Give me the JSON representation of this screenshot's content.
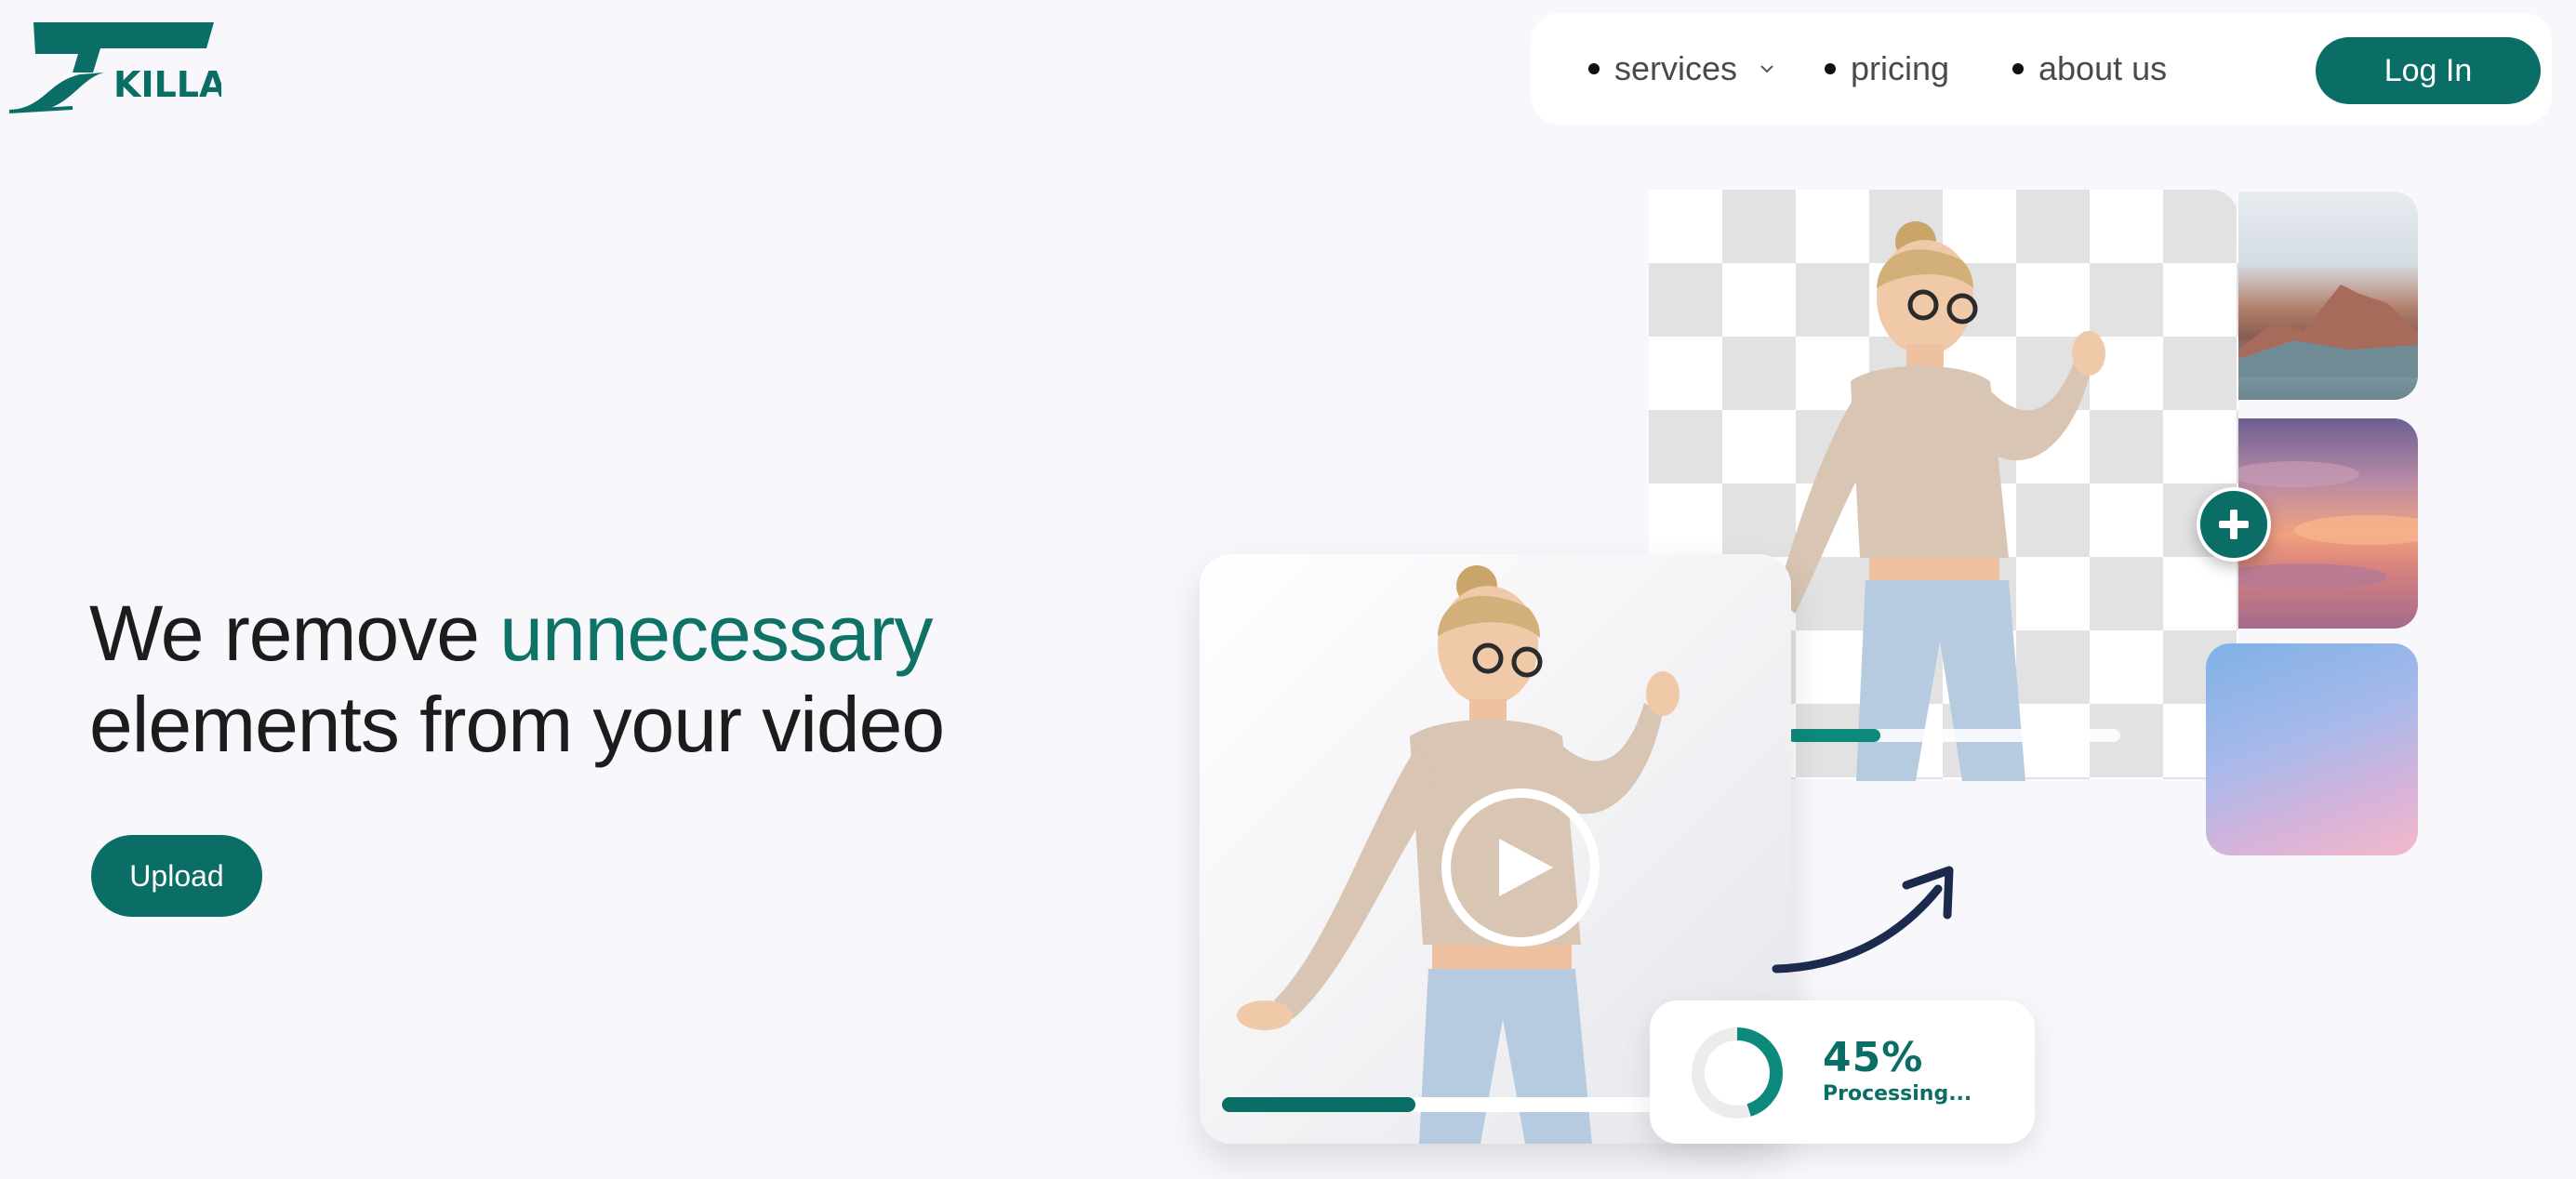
{
  "brand": {
    "name": "KILLA",
    "color": "#0b6e66"
  },
  "nav": {
    "items": [
      {
        "label": "services",
        "has_dropdown": true
      },
      {
        "label": "pricing",
        "has_dropdown": false
      },
      {
        "label": "about us",
        "has_dropdown": false
      }
    ],
    "login_label": "Log In"
  },
  "hero": {
    "headline_part1": "We remove ",
    "headline_accent": "unnecessary",
    "headline_part2": "elements from your video",
    "upload_label": "Upload"
  },
  "processing": {
    "percent": 45,
    "percent_label": "45%",
    "status": "Processing..."
  },
  "video_progress": 0.4,
  "background_progress": 0.28,
  "colors": {
    "accent": "#0b6e66",
    "accent_text": "#0e7366",
    "page_bg": "#f7f7fc",
    "arrow": "#1c2a4d"
  },
  "icons": [
    "logo-mark",
    "chevron-down-icon",
    "plus-icon",
    "play-icon",
    "arrow-icon"
  ]
}
